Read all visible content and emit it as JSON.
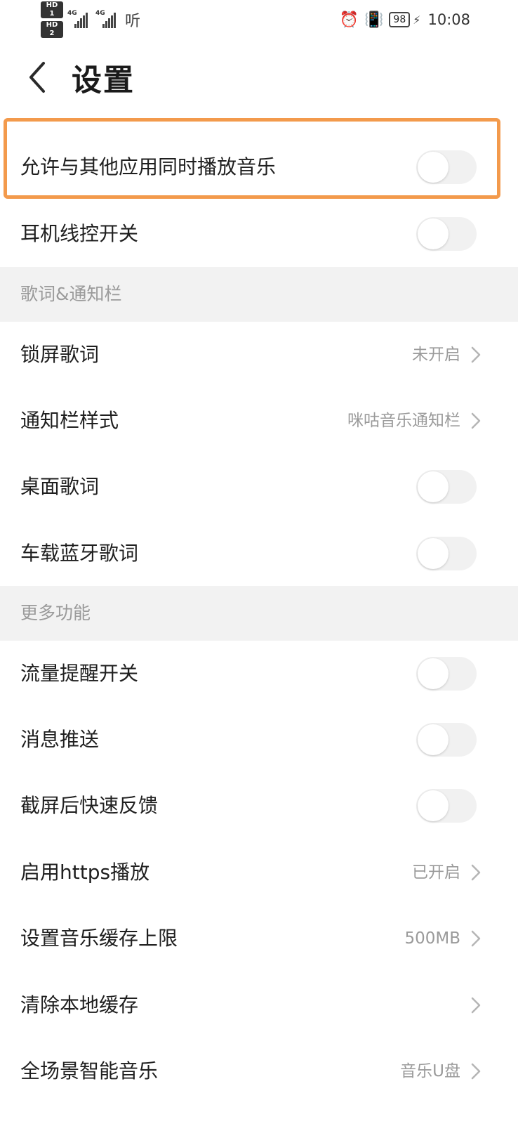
{
  "status_bar": {
    "hd1": "HD 1",
    "hd2": "HD 2",
    "sig1_tag": "4G",
    "sig2_tag": "4G",
    "network_text": "听",
    "battery": "98",
    "time": "10:08"
  },
  "header": {
    "title": "设置"
  },
  "rows": {
    "allow_mix": {
      "label": "允许与其他应用同时播放音乐",
      "toggle_on": false
    },
    "headset": {
      "label": "耳机线控开关",
      "toggle_on": false
    },
    "lock_lyrics": {
      "label": "锁屏歌词",
      "value": "未开启"
    },
    "notify_style": {
      "label": "通知栏样式",
      "value": "咪咕音乐通知栏"
    },
    "desktop_lyrics": {
      "label": "桌面歌词",
      "toggle_on": false
    },
    "car_lyrics": {
      "label": "车载蓝牙歌词",
      "toggle_on": false
    },
    "traffic_alert": {
      "label": "流量提醒开关",
      "toggle_on": false
    },
    "push": {
      "label": "消息推送",
      "toggle_on": false
    },
    "screenshot_feedback": {
      "label": "截屏后快速反馈",
      "toggle_on": false
    },
    "https": {
      "label": "启用https播放",
      "value": "已开启"
    },
    "cache_limit": {
      "label": "设置音乐缓存上限",
      "value": "500MB"
    },
    "clear_cache": {
      "label": "清除本地缓存",
      "value": ""
    },
    "scene_music": {
      "label": "全场景智能音乐",
      "value": "音乐U盘"
    }
  },
  "sections": {
    "lyrics_notify": "歌词&通知栏",
    "more": "更多功能"
  },
  "colors": {
    "highlight": "#f39a4c",
    "section_bg": "#f2f2f2",
    "toggle_off": "#f1f1f1"
  }
}
